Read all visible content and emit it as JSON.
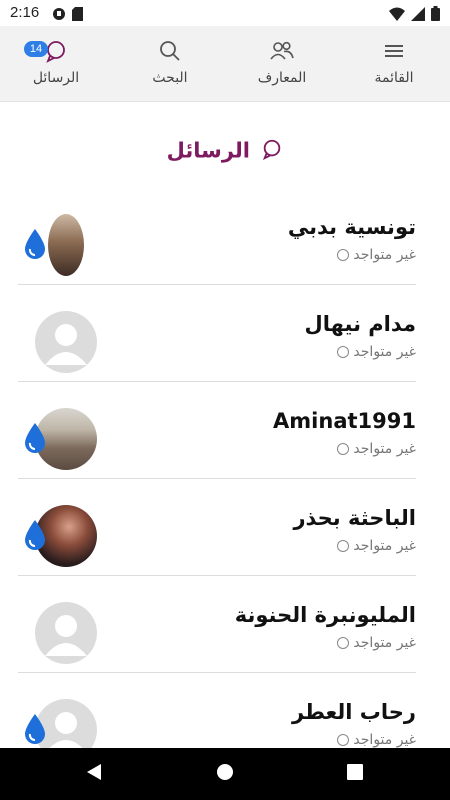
{
  "status_bar": {
    "time": "2:16",
    "icons": [
      "notification-icon",
      "sim-card-icon",
      "wifi-icon",
      "signal-icon",
      "battery-icon"
    ]
  },
  "nav": {
    "items": [
      {
        "label": "القائمة",
        "icon": "menu-icon"
      },
      {
        "label": "المعارف",
        "icon": "people-icon"
      },
      {
        "label": "البحث",
        "icon": "search-icon"
      },
      {
        "label": "الرسائل",
        "icon": "chat-icon",
        "badge": "14"
      }
    ]
  },
  "page": {
    "title": "الرسائل",
    "title_icon": "chat-icon"
  },
  "messages": [
    {
      "name": "تونسية بدبي",
      "status": "غير متواجد",
      "avatar": "photo",
      "drop_icon": true
    },
    {
      "name": "مدام نيهال",
      "status": "غير متواجد",
      "avatar": "placeholder",
      "drop_icon": false
    },
    {
      "name": "Aminat1991",
      "status": "غير متواجد",
      "avatar": "photo",
      "drop_icon": true
    },
    {
      "name": "الباحثة بحذر",
      "status": "غير متواجد",
      "avatar": "photo",
      "drop_icon": true
    },
    {
      "name": "المليونبرة الحنونة",
      "status": "غير متواجد",
      "avatar": "placeholder",
      "drop_icon": false
    },
    {
      "name": "رحاب العطر",
      "status": "غير متواجد",
      "avatar": "placeholder",
      "drop_icon": true
    }
  ],
  "colors": {
    "accent": "#7d1a60",
    "badge": "#2f7ee6",
    "drop": "#1e6fd9",
    "nav_bg": "#f2f2f2"
  },
  "system_nav": [
    "back-icon",
    "home-icon",
    "recents-icon"
  ]
}
